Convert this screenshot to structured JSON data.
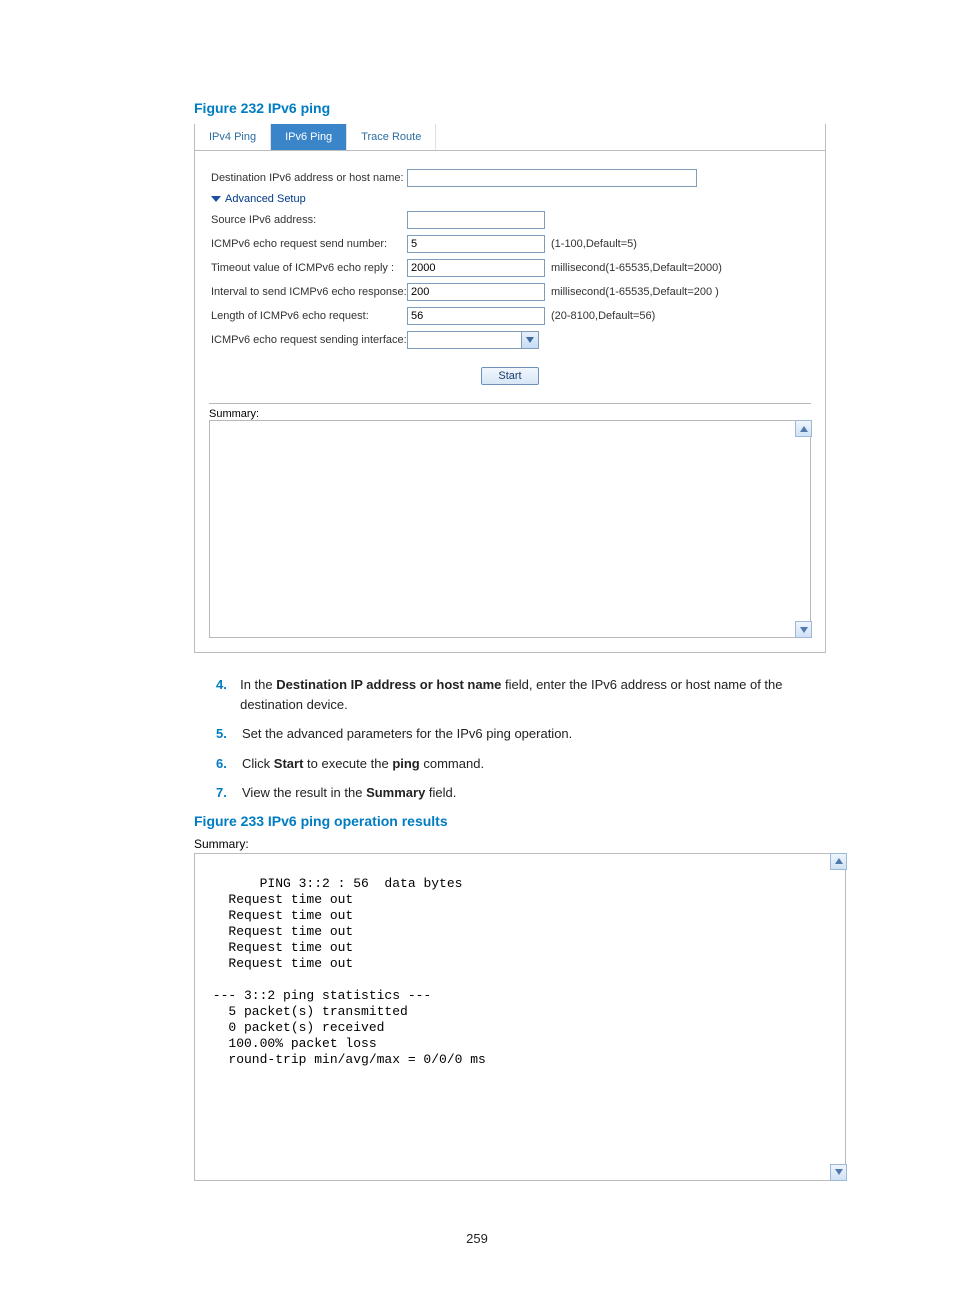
{
  "figure232": {
    "caption": "Figure 232 IPv6 ping"
  },
  "tabs": {
    "ipv4": "IPv4 Ping",
    "ipv6": "IPv6 Ping",
    "trace": "Trace Route"
  },
  "form": {
    "dest_label": "Destination IPv6 address or host name:",
    "adv_label": "Advanced Setup",
    "src_label": "Source IPv6 address:",
    "sendnum_label": "ICMPv6 echo request send number:",
    "sendnum_value": "5",
    "sendnum_hint": "(1-100,Default=5)",
    "timeout_label": "Timeout value of ICMPv6 echo reply :",
    "timeout_value": "2000",
    "timeout_hint": "millisecond(1-65535,Default=2000)",
    "interval_label": "Interval to send ICMPv6 echo response:",
    "interval_value": "200",
    "interval_hint": "millisecond(1-65535,Default=200 )",
    "length_label": "Length of ICMPv6 echo request:",
    "length_value": "56",
    "length_hint": "(20-8100,Default=56)",
    "iface_label": "ICMPv6 echo request sending interface:",
    "start": "Start",
    "summary_label": "Summary:"
  },
  "steps": {
    "s4a": "In the ",
    "s4b": "Destination IP address or host name",
    "s4c": " field, enter the IPv6 address or host name of the destination device.",
    "s5": "Set the advanced parameters for the IPv6 ping operation.",
    "s6a": "Click ",
    "s6b": "Start",
    "s6c": " to execute the ",
    "s6d": "ping",
    "s6e": " command.",
    "s7a": "View the result in the ",
    "s7b": "Summary",
    "s7c": " field.",
    "n4": "4.",
    "n5": "5.",
    "n6": "6.",
    "n7": "7."
  },
  "figure233": {
    "caption": "Figure 233 IPv6 ping operation results"
  },
  "summary2_label": "Summary:",
  "results": " PING 3::2 : 56  data bytes\n   Request time out\n   Request time out\n   Request time out\n   Request time out\n   Request time out\n\n --- 3::2 ping statistics ---\n   5 packet(s) transmitted\n   0 packet(s) received\n   100.00% packet loss\n   round-trip min/avg/max = 0/0/0 ms",
  "page_num": "259"
}
